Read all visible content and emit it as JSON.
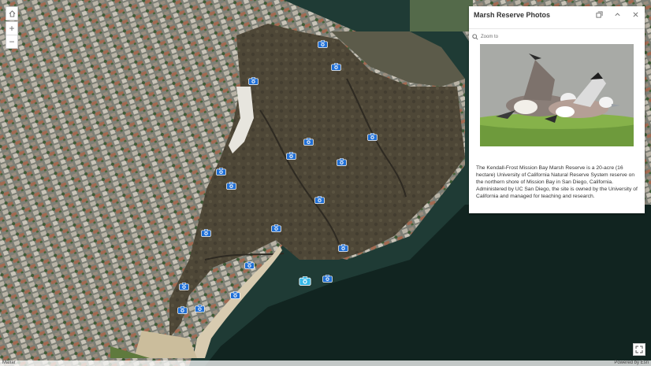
{
  "popup": {
    "title": "Marsh Reserve Photos",
    "zoom_to": "Zoom to",
    "description": "The Kendall-Frost Mission Bay Marsh Reserve is a 20-acre (16 hectare) University of California Natural Reserve System reserve on the northern shore of Mission Bay in San Diego, California. Administered by UC San Diego, the site is owned by the University of California and managed for teaching and research.",
    "icons": {
      "dock": "dock-icon",
      "collapse": "chevron-up-icon",
      "close": "close-icon",
      "zoom": "magnifier-icon"
    }
  },
  "map": {
    "controls": {
      "home": "home-icon",
      "zoom_in": "+",
      "zoom_out": "−",
      "fullscreen": "expand-icon"
    },
    "photo_marker_count": 20,
    "selected_marker": 11,
    "colors": {
      "marker": "#1f6fd6",
      "marker_selected": "#35b8e8"
    }
  },
  "attribution": {
    "left": "Maxar",
    "right": "Powered by Esri"
  }
}
